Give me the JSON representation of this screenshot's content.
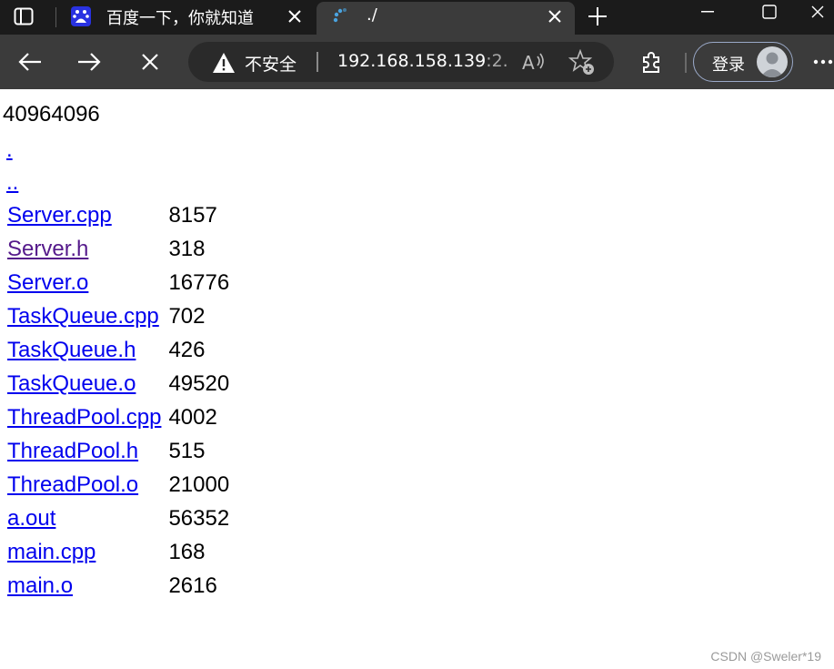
{
  "browser": {
    "tabs": [
      {
        "title": "百度一下，你就知道",
        "favicon": "baidu-icon",
        "active": false
      },
      {
        "title": "./",
        "favicon": "loading-spinner-icon",
        "active": true
      }
    ],
    "address": {
      "security_label": "不安全",
      "url_host": "192.168.158.139",
      "url_rest": ":2..."
    },
    "account": {
      "login_label": "登录"
    }
  },
  "page": {
    "header": "40964096",
    "dir_links": [
      ".",
      ".."
    ],
    "files": [
      {
        "name": "Server.cpp",
        "size": "8157",
        "visited": false
      },
      {
        "name": "Server.h",
        "size": "318",
        "visited": true
      },
      {
        "name": "Server.o",
        "size": "16776",
        "visited": false
      },
      {
        "name": "TaskQueue.cpp",
        "size": "702",
        "visited": false
      },
      {
        "name": "TaskQueue.h",
        "size": "426",
        "visited": false
      },
      {
        "name": "TaskQueue.o",
        "size": "49520",
        "visited": false
      },
      {
        "name": "ThreadPool.cpp",
        "size": "4002",
        "visited": false
      },
      {
        "name": "ThreadPool.h",
        "size": "515",
        "visited": false
      },
      {
        "name": "ThreadPool.o",
        "size": "21000",
        "visited": false
      },
      {
        "name": "a.out",
        "size": "56352",
        "visited": false
      },
      {
        "name": "main.cpp",
        "size": "168",
        "visited": false
      },
      {
        "name": "main.o",
        "size": "2616",
        "visited": false
      }
    ],
    "watermark": "CSDN @Sweler*19"
  },
  "colors": {
    "link": "#0000ee",
    "visited_link": "#551a8b",
    "tabstrip": "#1b1b1b",
    "toolbar": "#3b3b3b"
  }
}
